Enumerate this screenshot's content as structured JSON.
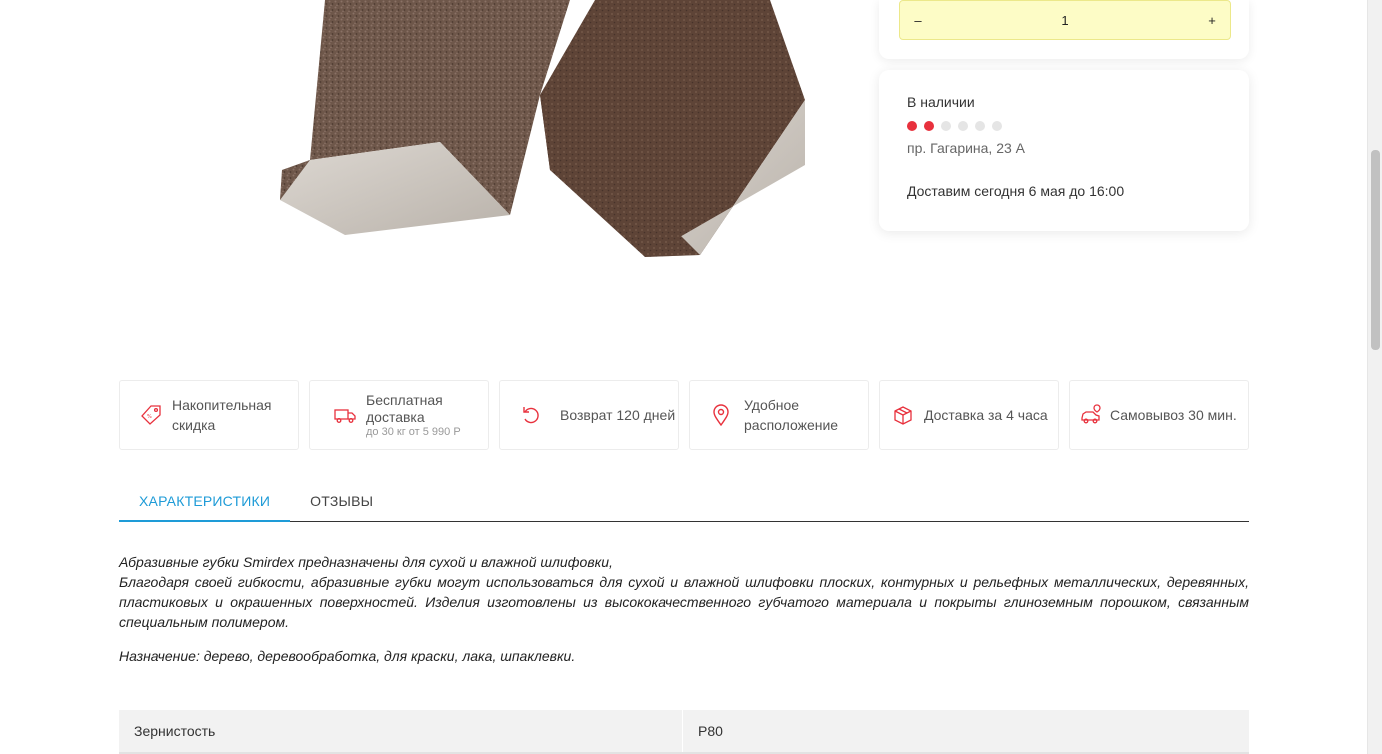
{
  "quantity": {
    "minus": "–",
    "value": "1",
    "plus": "+"
  },
  "availability": {
    "status": "В наличии",
    "stock_level": 2,
    "stock_max": 6,
    "address": "пр. Гагарина, 23 А",
    "delivery": "Доставим сегодня 6 мая до 16:00"
  },
  "features": [
    {
      "icon": "discount-tag-icon",
      "line1": "Накопительная",
      "line2": "скидка",
      "sub": ""
    },
    {
      "icon": "free-delivery-truck-icon",
      "line1": "Бесплатная",
      "line2": "доставка",
      "sub": "до 30 кг от 5 990 Р"
    },
    {
      "icon": "return-arrow-icon",
      "line1": "Возврат 120 дней",
      "line2": "",
      "sub": ""
    },
    {
      "icon": "location-pin-icon",
      "line1": "Удобное",
      "line2": "расположение",
      "sub": ""
    },
    {
      "icon": "package-box-icon",
      "line1": "Доставка за 4 часа",
      "line2": "",
      "sub": ""
    },
    {
      "icon": "pickup-car-icon",
      "line1": "Самовывоз 30 мин.",
      "line2": "",
      "sub": ""
    }
  ],
  "tabs": [
    {
      "label": "ХАРАКТЕРИСТИКИ",
      "active": true
    },
    {
      "label": "ОТЗЫВЫ",
      "active": false
    }
  ],
  "description": {
    "line1": "Абразивные губки Smirdex предназначены для сухой и влажной шлифовки,",
    "line2": "Благодаря своей гибкости, абразивные губки могут использоваться для сухой и влажной шлифовки плоских, контурных и рельефных металлических, деревянных, пластиковых и окрашенных поверхностей. Изделия изготовлены из высококачественного губчатого материала и покрыты глиноземным порошком, связанным специальным полимером.",
    "purpose": "Назначение: дерево, деревообработка, для краски, лака, шпаклевки."
  },
  "specs": [
    {
      "name": "Зернистость",
      "value": "P80"
    }
  ],
  "colors": {
    "accent": "#1e9bd7",
    "stock_on": "#e8313d",
    "stepper_bg": "#fdfcc6",
    "icon_red": "#e8313d"
  }
}
